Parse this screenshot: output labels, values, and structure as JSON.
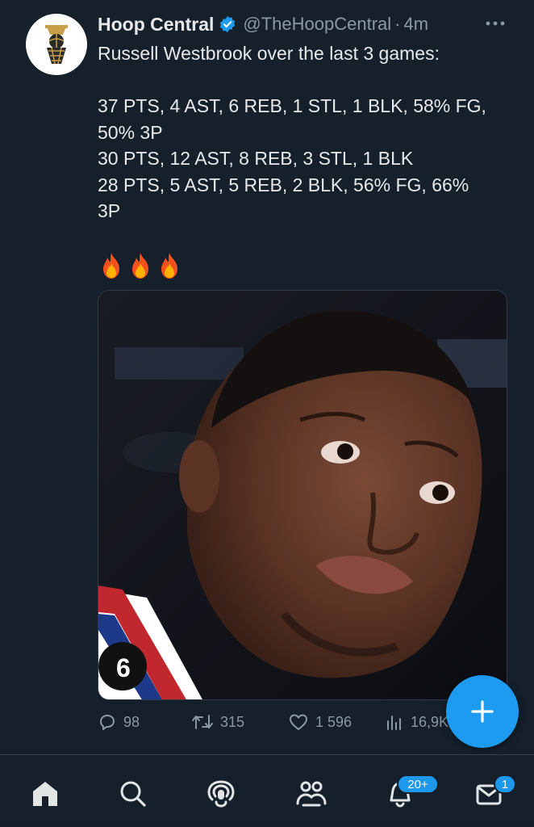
{
  "tweet": {
    "author": {
      "display_name": "Hoop Central",
      "handle": "@TheHoopCentral",
      "verified": true,
      "avatar_icon": "basketball-hoop-logo-icon"
    },
    "separator": "·",
    "time": "4m",
    "text_lines": [
      "Russell Westbrook over the last 3 games:",
      "",
      "37 PTS, 4 AST, 6 REB, 1 STL, 1 BLK, 58% FG,",
      "50% 3P",
      "30 PTS, 12 AST, 8 REB, 3 STL, 1 BLK",
      "28 PTS, 5 AST, 5 REB, 2 BLK, 56% FG, 66%",
      "3P",
      ""
    ],
    "emojis": [
      "fire-icon",
      "fire-icon",
      "fire-icon"
    ],
    "media": {
      "type": "photo"
    },
    "actions": {
      "replies": "98",
      "retweets": "315",
      "likes": "1 596",
      "views": "16,9K"
    }
  },
  "fab": {
    "icon": "plus-icon"
  },
  "bottom_nav": {
    "items": [
      "home-icon",
      "search-icon",
      "spaces-icon",
      "communities-icon",
      "notifications-icon",
      "messages-icon"
    ],
    "notifications_badge": "20+",
    "messages_badge": "1"
  },
  "colors": {
    "background": "#15202b",
    "text": "#e7e9ea",
    "secondary_text": "#8b98a5",
    "accent": "#1d9bf0"
  }
}
